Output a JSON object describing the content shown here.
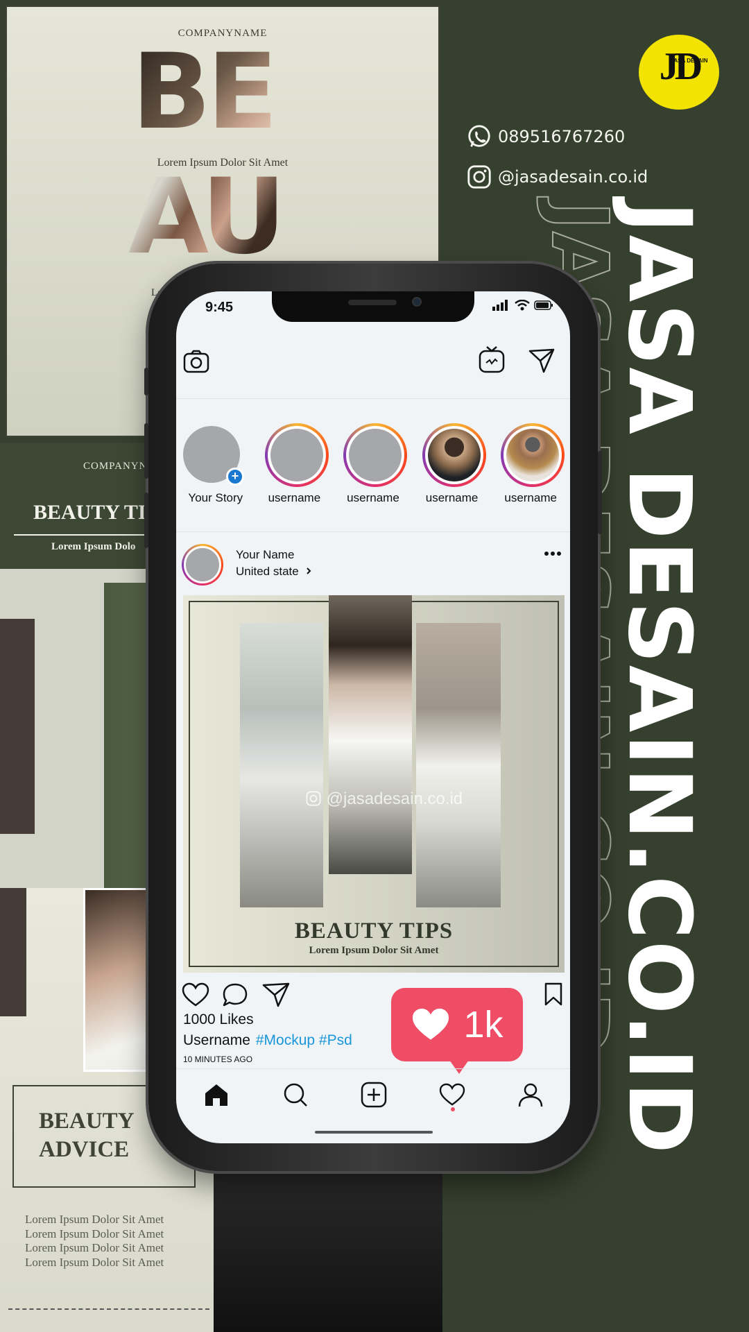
{
  "posters": {
    "top_left": {
      "company": "COMPANYNAME",
      "word1": "BE",
      "word2": "AU",
      "subtitle": "Lorem Ipsum Dolor Sit Amet",
      "subtitle_partial": "Lor"
    },
    "middle_left": {
      "company": "COMPANYN",
      "title": "BEAUTY TI",
      "subtitle": "Lorem Ipsum Dolo"
    },
    "bottom_left": {
      "title": "BEAUTY\nADVICE",
      "lines": [
        "Lorem Ipsum Dolor Sit Amet",
        "Lorem Ipsum Dolor Sit Amet",
        "Lorem Ipsum Dolor Sit Amet",
        "Lorem Ipsum Dolor Sit Amet"
      ]
    }
  },
  "brand": {
    "logo_mark": "JD",
    "logo_text": "JASA DESAIN",
    "phone": "089516767260",
    "instagram": "@jasadesain.co.id",
    "vertical_text": "JASA DESAIN.CO.ID",
    "accent_yellow": "#f2e300",
    "background_green": "#36402e"
  },
  "phone_screen": {
    "status": {
      "time": "9:45"
    },
    "stories": [
      {
        "label": "Your Story",
        "own": true
      },
      {
        "label": "username",
        "own": false
      },
      {
        "label": "username",
        "own": false
      },
      {
        "label": "username",
        "own": false
      },
      {
        "label": "username",
        "own": false
      }
    ],
    "post": {
      "author": "Your Name",
      "location": "United state",
      "image_title": "BEAUTY TIPS",
      "image_subtitle": "Lorem Ipsum Dolor Sit Amet",
      "watermark": "@jasadesain.co.id",
      "likes": "1000 Likes",
      "username": "Username",
      "hashtags": "#Mockup #Psd",
      "time_ago": "10 MINUTES AGO"
    },
    "like_notification": {
      "count": "1k"
    },
    "icons": {
      "top_left": "camera-icon",
      "top_right": [
        "igtv-icon",
        "direct-message-icon"
      ],
      "actions": [
        "heart-icon",
        "comment-icon",
        "share-icon",
        "bookmark-icon"
      ],
      "tabs": [
        "home-icon",
        "search-icon",
        "add-post-icon",
        "activity-heart-icon",
        "profile-icon"
      ]
    },
    "colors": {
      "like_red": "#ef4d65",
      "hashtag_blue": "#1a96d9",
      "story_plus_blue": "#1b78d1"
    }
  }
}
